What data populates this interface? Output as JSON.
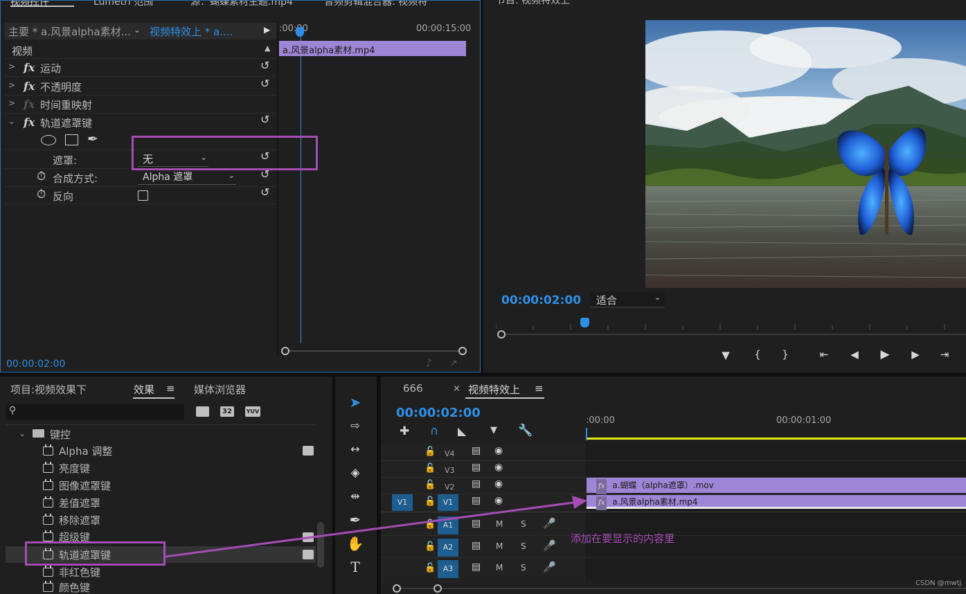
{
  "effect_controls": {
    "tabs": [
      "视频控件",
      "Lumetri 范围",
      "源：蝴蝶素材主题.mp4",
      "音频剪辑混合器: 视频特"
    ],
    "master_label": "主要 * a.风景alpha素材...",
    "sequence_label": "视频特效上 * a....",
    "ruler_start": ":00:00",
    "ruler_end": "00:00:15:00",
    "clip_label": "a.风景alpha素材.mp4",
    "section_video": "视频",
    "effects": [
      {
        "label": "运动",
        "fx_active": true
      },
      {
        "label": "不透明度",
        "fx_active": true
      },
      {
        "label": "时间重映射",
        "fx_active": false
      },
      {
        "label": "轨道遮罩键",
        "fx_active": true
      }
    ],
    "mask_label": "遮罩:",
    "mask_value": "无",
    "composite_label": "合成方式:",
    "composite_value": "Alpha 遮罩",
    "reverse_label": "反向",
    "timecode": "00:00:02:00"
  },
  "program_monitor": {
    "title": "节目: 视频特效上",
    "timecode": "00:00:02:00",
    "fit_value": "适合"
  },
  "project_panel": {
    "tab_project": "项目:视频效果下",
    "tab_effects": "效果",
    "tab_media": "媒体浏览器",
    "search_placeholder": "",
    "badges": [
      "32",
      "YUV"
    ],
    "folder": "键控",
    "items": [
      "Alpha 调整",
      "亮度键",
      "图像遮罩键",
      "差值遮罩",
      "移除遮罩",
      "超级键",
      "轨道遮罩键",
      "非红色键",
      "颜色键"
    ]
  },
  "timeline": {
    "tab_other": "666",
    "tab_active": "视频特效上",
    "timecode": "00:00:02:00",
    "ruler_start": ":00:00",
    "ruler_mark": "00:00:01:00",
    "video_tracks": [
      "V4",
      "V3",
      "V2",
      "V1"
    ],
    "source_patch": "V1",
    "audio_tracks": [
      "A1",
      "A2",
      "A3"
    ],
    "m_label": "M",
    "s_label": "S",
    "clip_v2": "a.蝴蝶（alpha遮罩）.mov",
    "clip_v1": "a.风景alpha素材.mp4",
    "fx_label": "fx",
    "annotation": "添加在要显示的内容里"
  },
  "watermark": "CSDN @mwtj",
  "colors": {
    "accent_blue": "#2e8fe6",
    "clip_purple": "#9e86d6",
    "annotation_purple": "#a64cb5",
    "playhead_yellow": "#e6e616"
  }
}
